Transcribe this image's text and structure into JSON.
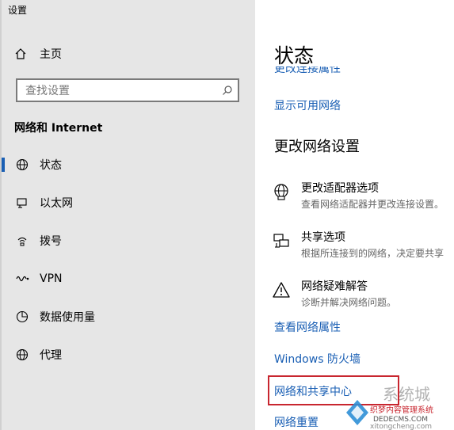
{
  "app": {
    "title": "设置"
  },
  "sidebar": {
    "home_label": "主页",
    "search_placeholder": "查找设置",
    "section_title": "网络和 Internet",
    "items": [
      {
        "label": "状态",
        "icon": "globe-icon",
        "selected": true
      },
      {
        "label": "以太网",
        "icon": "ethernet-icon"
      },
      {
        "label": "拨号",
        "icon": "dialup-icon"
      },
      {
        "label": "VPN",
        "icon": "vpn-icon"
      },
      {
        "label": "数据使用量",
        "icon": "data-usage-icon"
      },
      {
        "label": "代理",
        "icon": "globe-icon"
      }
    ]
  },
  "main": {
    "title": "状态",
    "cut_link": "更改连接属性",
    "show_networks_link": "显示可用网络",
    "change_settings_title": "更改网络设置",
    "options": [
      {
        "title": "更改适配器选项",
        "desc": "查看网络适配器并更改连接设置。",
        "icon": "adapter-globe-icon"
      },
      {
        "title": "共享选项",
        "desc": "根据所连接到的网络，决定要共享",
        "icon": "sharing-icon"
      },
      {
        "title": "网络疑难解答",
        "desc": "诊断并解决网络问题。",
        "icon": "warning-icon"
      }
    ],
    "links": {
      "properties": "查看网络属性",
      "firewall": "Windows 防火墙",
      "sharing_center": "网络和共享中心",
      "reset": "网络重置"
    }
  },
  "watermark": {
    "brand": "系统城",
    "cn_text": "织梦内容管理系统",
    "url1": "DEDECMS.COM",
    "url2": "xitongcheng.com"
  },
  "colors": {
    "link": "#1a5fb4",
    "sidebar_bg": "#e6e6e6",
    "highlight": "#c8262f"
  }
}
